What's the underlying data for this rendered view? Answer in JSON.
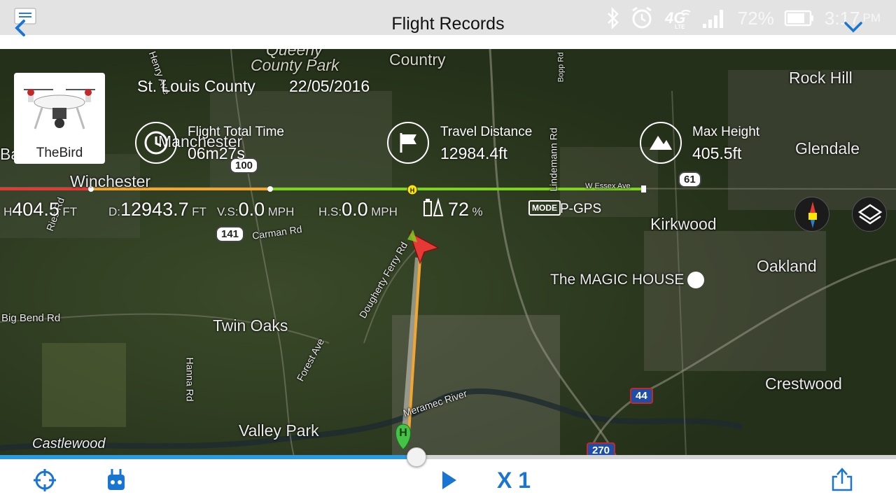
{
  "header": {
    "title": "Flight Records",
    "battery_percent": "72%",
    "time": "3:17",
    "ampm": "PM"
  },
  "flight": {
    "drone_name": "TheBird",
    "location": "St. Louis County",
    "date": "22/05/2016",
    "total_time_label": "Flight Total Time",
    "total_time_value": "06m27s",
    "travel_distance_label": "Travel Distance",
    "travel_distance_value": "12984.4ft",
    "max_height_label": "Max Height",
    "max_height_value": "405.5ft"
  },
  "telemetry": {
    "h_key": "H",
    "h_value": "404.5",
    "h_unit": "FT",
    "d_key": "D:",
    "d_value": "12943.7",
    "d_unit": "FT",
    "vs_key": "V.S:",
    "vs_value": "0.0",
    "vs_unit": "MPH",
    "hs_key": "H.S:",
    "hs_value": "0.0",
    "hs_unit": "MPH",
    "battery_value": "72",
    "battery_unit": "%",
    "mode_badge": "MODE",
    "mode_value": "P-GPS"
  },
  "map": {
    "places": {
      "queeny": "Queeny",
      "county_park": "County Park",
      "country": "Country",
      "rock_hill": "Rock Hill",
      "manchester": "Manchester",
      "glendale": "Glendale",
      "winchester": "Winchester",
      "kirkwood": "Kirkwood",
      "magic_house": "The MAGIC HOUSE",
      "oakland": "Oakland",
      "twin_oaks": "Twin Oaks",
      "big_bend_rd": "Big Bend Rd",
      "crestwood": "Crestwood",
      "valley_park": "Valley Park",
      "castlewood": "Castlewood",
      "carman_rd": "Carman Rd",
      "dougherty_ferry": "Dougherty Ferry Rd",
      "forest_ave": "Forest Ave",
      "hanna_rd": "Hanna Rd",
      "meramec_river": "Meramec River",
      "lindemann_rd": "Lindemann Rd",
      "w_essex_ave": "W Essex Ave",
      "henry_ave": "Henry Ave",
      "ries_rd": "Ries Rd",
      "bopp_rd": "Bopp Rd",
      "ba_partial": "Ba"
    },
    "shields": {
      "hwy_100": "100",
      "hwy_61": "61",
      "hwy_141": "141",
      "i_44": "44",
      "i_270": "270"
    },
    "home_marker": "H"
  },
  "playback": {
    "speed_label": "X 1",
    "progress": 0.465
  },
  "colors": {
    "accent_blue": "#1a75d2",
    "progress_blue": "#2b9be0",
    "path_orange": "#f2a531",
    "track_red": "#e53935",
    "track_green": "#7ed321"
  }
}
